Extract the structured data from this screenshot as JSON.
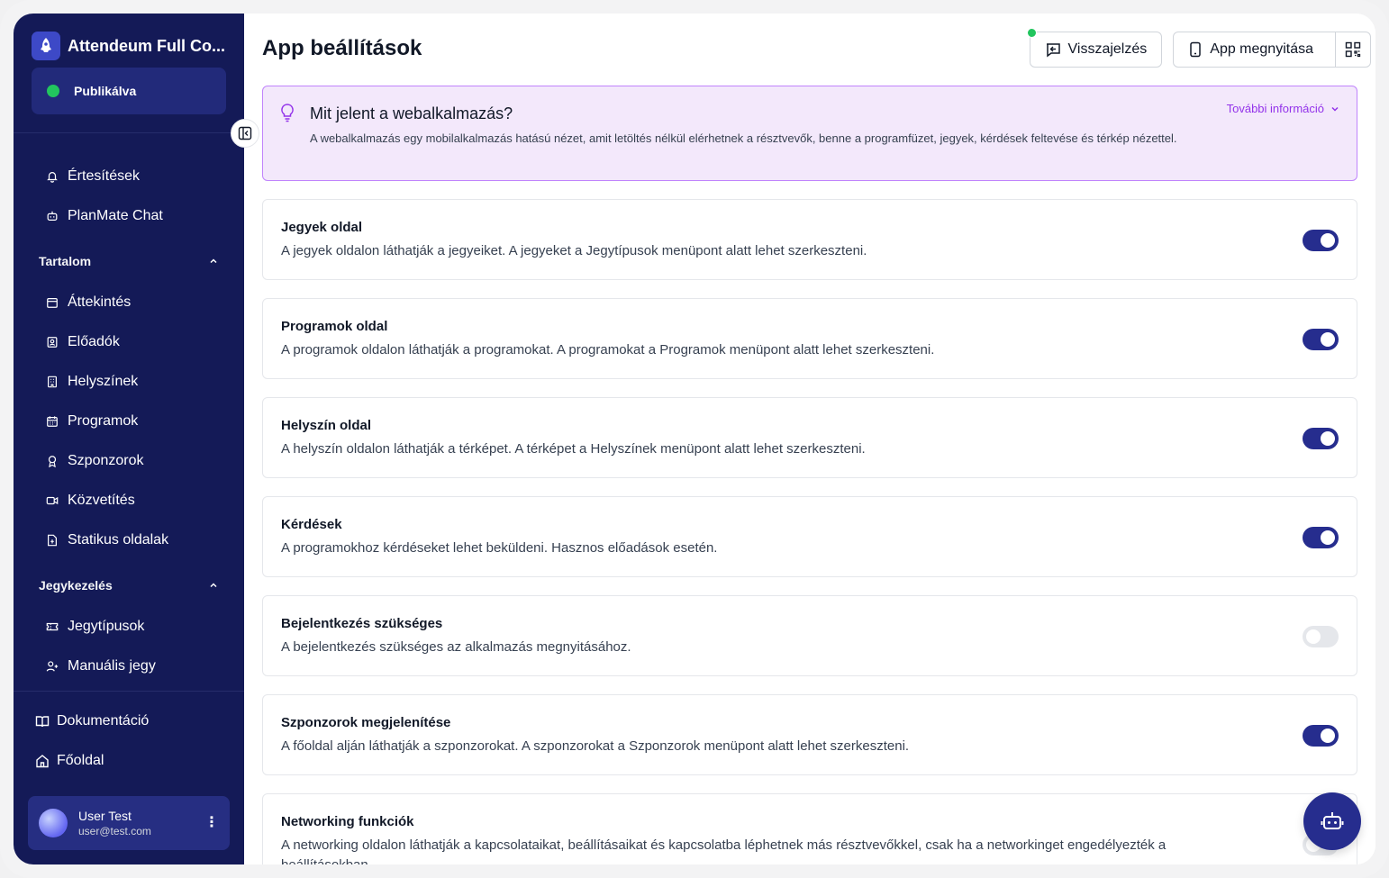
{
  "sidebar": {
    "brand_name": "Attendeum Full Co...",
    "status_label": "Publikálva",
    "items_top": [
      {
        "label": "Értesítések",
        "icon": "bell-icon"
      },
      {
        "label": "PlanMate Chat",
        "icon": "bot-icon"
      }
    ],
    "section_content": "Tartalom",
    "items_content": [
      {
        "label": "Áttekintés",
        "icon": "calendar-icon"
      },
      {
        "label": "Előadók",
        "icon": "contact-icon"
      },
      {
        "label": "Helyszínek",
        "icon": "building-icon"
      },
      {
        "label": "Programok",
        "icon": "calendar-days-icon"
      },
      {
        "label": "Szponzorok",
        "icon": "award-icon"
      },
      {
        "label": "Közvetítés",
        "icon": "video-icon"
      },
      {
        "label": "Statikus oldalak",
        "icon": "file-icon"
      }
    ],
    "section_tickets": "Jegykezelés",
    "items_tickets": [
      {
        "label": "Jegytípusok",
        "icon": "ticket-icon"
      },
      {
        "label": "Manuális jegy",
        "icon": "user-plus-icon"
      }
    ],
    "bottom": [
      {
        "label": "Dokumentáció",
        "icon": "book-icon"
      },
      {
        "label": "Főoldal",
        "icon": "home-icon"
      }
    ],
    "user": {
      "name": "User Test",
      "email": "user@test.com"
    }
  },
  "header": {
    "title": "App beállítások",
    "feedback_label": "Visszajelzés",
    "open_app_label": "App megnyitása"
  },
  "info": {
    "title": "Mit jelent a webalkalmazás?",
    "text": "A webalkalmazás egy mobilalkalmazás hatású nézet, amit letöltés nélkül elérhetnek a résztvevők, benne a programfüzet, jegyek, kérdések feltevése és térkép nézettel.",
    "more_label": "További információ"
  },
  "settings": [
    {
      "title": "Jegyek oldal",
      "desc": "A jegyek oldalon láthatják a jegyeiket. A jegyeket a Jegytípusok menüpont alatt lehet szerkeszteni.",
      "enabled": true
    },
    {
      "title": "Programok oldal",
      "desc": "A programok oldalon láthatják a programokat. A programokat a Programok menüpont alatt lehet szerkeszteni.",
      "enabled": true
    },
    {
      "title": "Helyszín oldal",
      "desc": "A helyszín oldalon láthatják a térképet. A térképet a Helyszínek menüpont alatt lehet szerkeszteni.",
      "enabled": true
    },
    {
      "title": "Kérdések",
      "desc": "A programokhoz kérdéseket lehet beküldeni. Hasznos előadások esetén.",
      "enabled": true
    },
    {
      "title": "Bejelentkezés szükséges",
      "desc": "A bejelentkezés szükséges az alkalmazás megnyitásához.",
      "enabled": false
    },
    {
      "title": "Szponzorok megjelenítése",
      "desc": "A főoldal alján láthatják a szponzorokat. A szponzorokat a Szponzorok menüpont alatt lehet szerkeszteni.",
      "enabled": true
    },
    {
      "title": "Networking funkciók",
      "desc": "A networking oldalon láthatják a kapcsolataikat, beállításaikat és kapcsolatba léphetnek más résztvevőkkel, csak ha a networkinget engedélyezték a beállításokban.",
      "enabled": false
    }
  ],
  "colors": {
    "sidebar_bg": "#141a57",
    "accent": "#262d8e",
    "success": "#22c55e",
    "info_bg": "#f3e8fb",
    "info_link": "#9333ea"
  }
}
